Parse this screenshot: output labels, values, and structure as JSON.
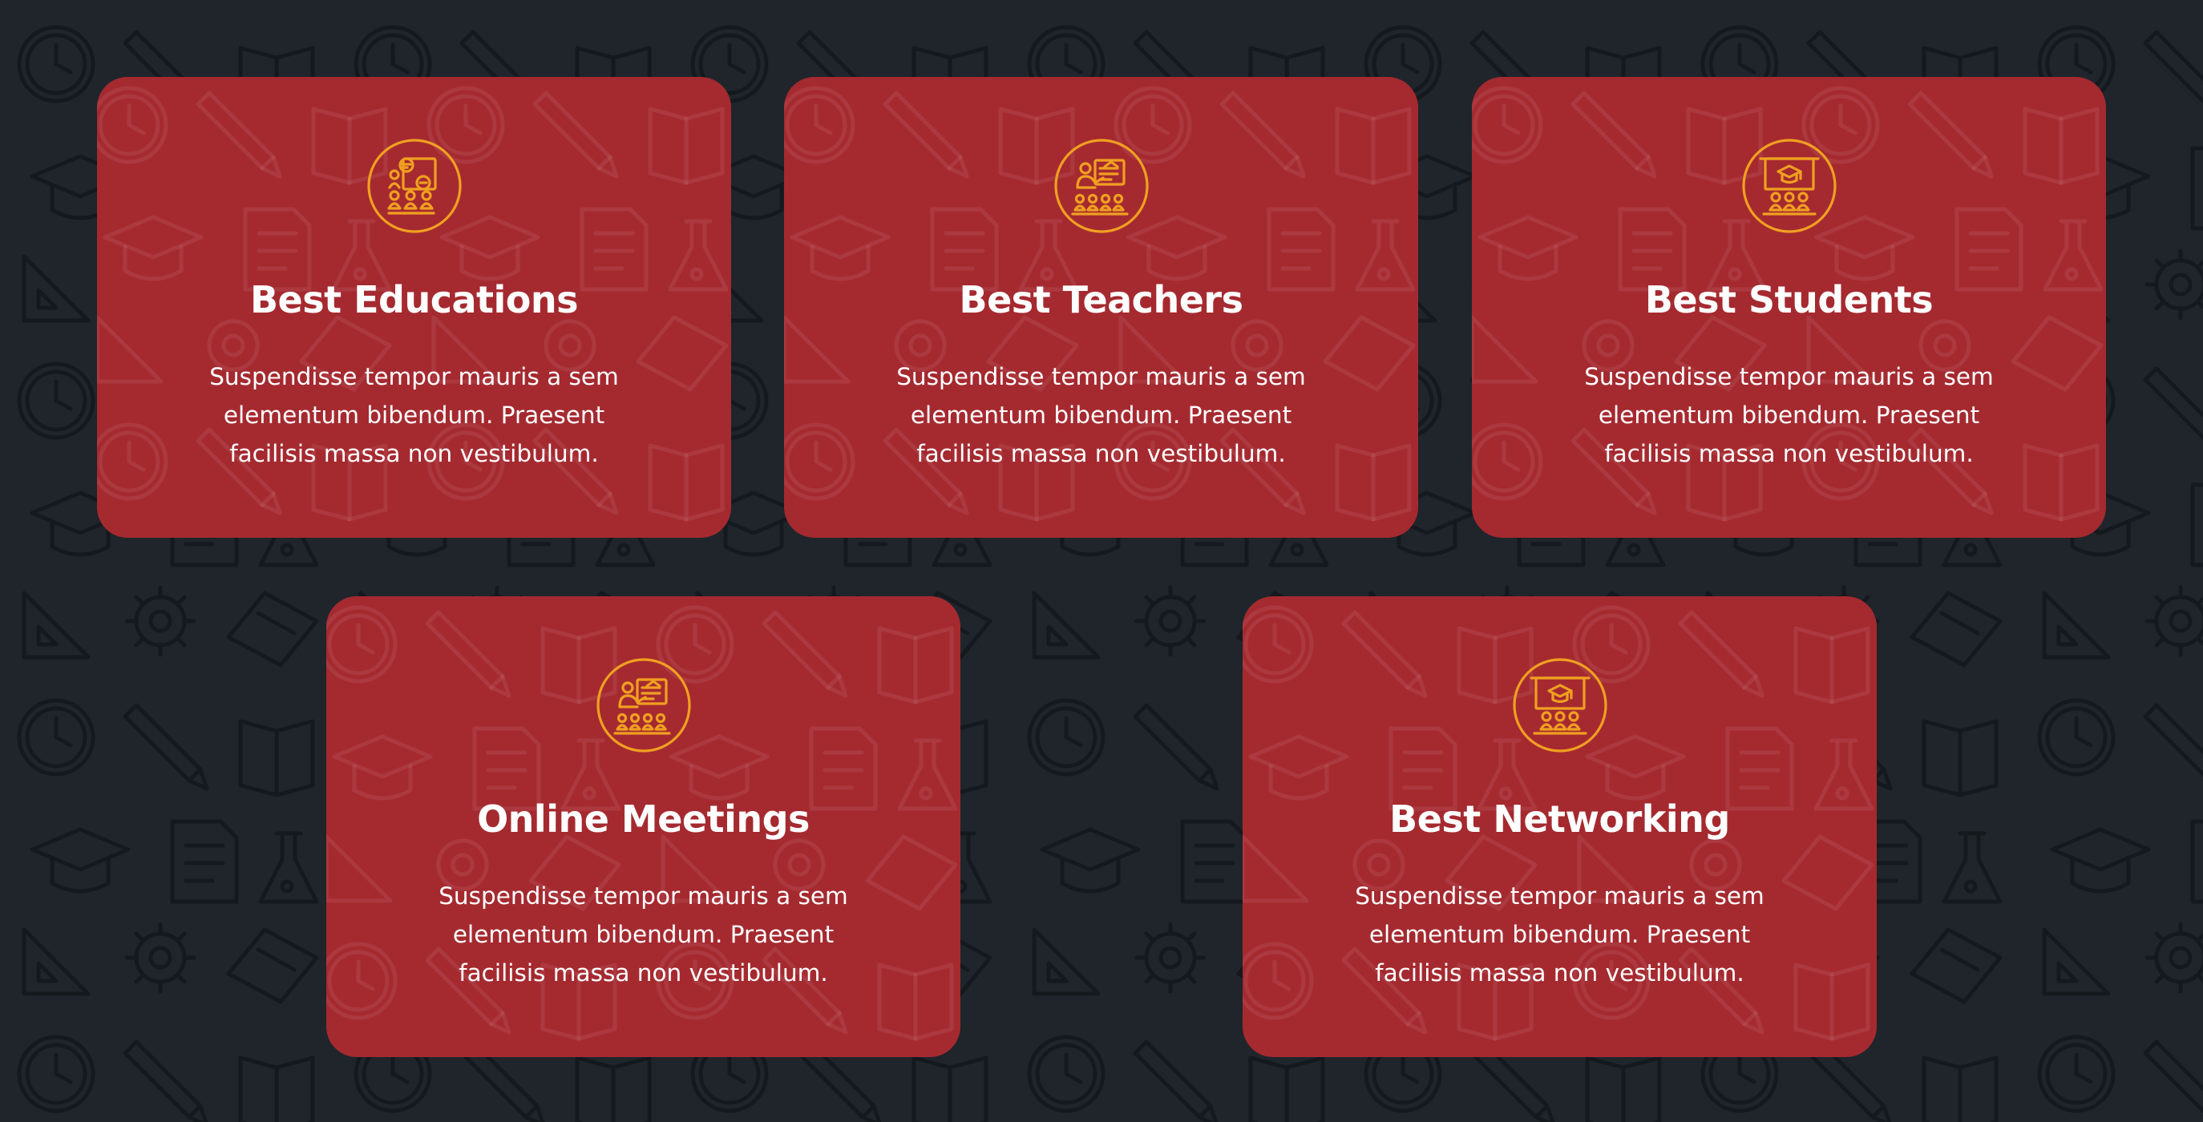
{
  "theme": {
    "background": "#1f252b",
    "card_background": "#a52a30",
    "icon_color": "#f0a020",
    "text_color": "#ffffff"
  },
  "features": [
    {
      "icon": "classroom-discussion-icon",
      "title": "Best Educations",
      "text": "Suspendisse tempor mauris a sem elementum bibendum. Praesent facilisis massa non vestibulum."
    },
    {
      "icon": "teacher-presentation-icon",
      "title": "Best Teachers",
      "text": "Suspendisse tempor mauris a sem elementum bibendum. Praesent facilisis massa non vestibulum."
    },
    {
      "icon": "graduation-board-icon",
      "title": "Best Students",
      "text": "Suspendisse tempor mauris a sem elementum bibendum. Praesent facilisis massa non vestibulum."
    },
    {
      "icon": "teacher-presentation-icon",
      "title": "Online Meetings",
      "text": "Suspendisse tempor mauris a sem elementum bibendum. Praesent facilisis massa non vestibulum."
    },
    {
      "icon": "graduation-board-icon",
      "title": "Best Networking",
      "text": "Suspendisse tempor mauris a sem elementum bibendum. Praesent facilisis massa non vestibulum."
    }
  ]
}
